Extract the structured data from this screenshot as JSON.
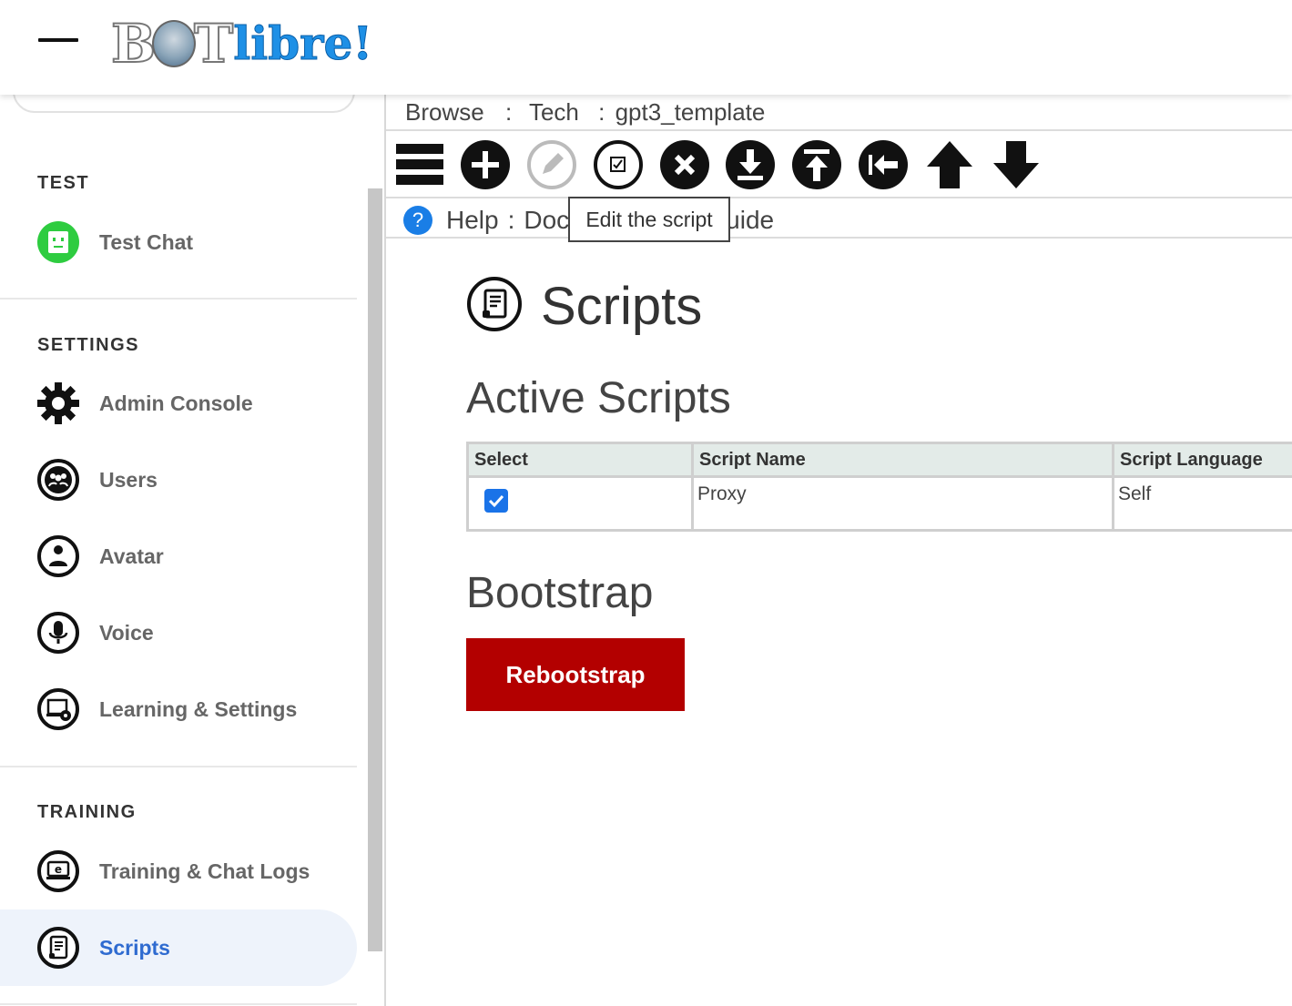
{
  "header": {
    "logo_text_bot": "B",
    "logo_text_t": "T",
    "logo_text_libre": "libre!"
  },
  "sidebar": {
    "sections": {
      "test": "TEST",
      "settings": "SETTINGS",
      "training": "TRAINING"
    },
    "items": [
      {
        "label": "Test Chat",
        "icon": "chat-face-icon"
      },
      {
        "label": "Admin Console",
        "icon": "gear-icon"
      },
      {
        "label": "Users",
        "icon": "users-icon"
      },
      {
        "label": "Avatar",
        "icon": "avatar-icon"
      },
      {
        "label": "Voice",
        "icon": "microphone-icon"
      },
      {
        "label": "Learning & Settings",
        "icon": "learning-settings-icon"
      },
      {
        "label": "Training & Chat Logs",
        "icon": "chat-logs-icon"
      },
      {
        "label": "Scripts",
        "icon": "script-icon",
        "active": true
      }
    ]
  },
  "breadcrumb": {
    "browse": "Browse",
    "sep": ":",
    "category": "Tech",
    "bot": "gpt3_template"
  },
  "toolbar": {
    "buttons": [
      "menu-icon",
      "add-icon",
      "edit-icon",
      "edit-script-icon",
      "delete-icon",
      "import-icon",
      "export-icon",
      "back-icon",
      "up-arrow-icon",
      "down-arrow-icon"
    ],
    "tooltip": "Edit the script"
  },
  "help": {
    "icon": "?",
    "label": "Help",
    "sep": ":",
    "link_left": "Doc",
    "link_right": "uide"
  },
  "page": {
    "title": "Scripts",
    "active_heading": "Active Scripts",
    "bootstrap_heading": "Bootstrap",
    "reboot_label": "Rebootstrap"
  },
  "table": {
    "headers": [
      "Select",
      "Script Name",
      "Script Language"
    ],
    "rows": [
      {
        "selected": true,
        "name": "Proxy",
        "language": "Self"
      }
    ]
  },
  "colors": {
    "accent": "#2f6bd0",
    "danger": "#b30000",
    "help": "#1a7ee6",
    "green": "#2ecc40"
  }
}
